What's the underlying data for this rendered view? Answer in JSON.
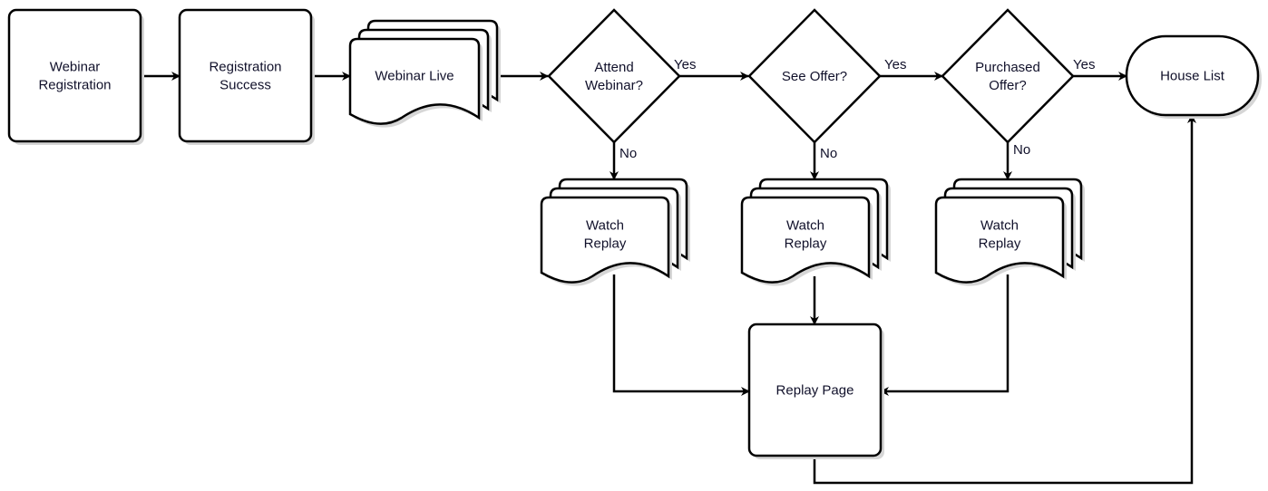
{
  "nodes": {
    "webinar_registration": {
      "lines": [
        "Webinar",
        "Registration"
      ],
      "shape": "rounded-rectangle"
    },
    "registration_success": {
      "lines": [
        "Registration",
        "Success"
      ],
      "shape": "rounded-rectangle"
    },
    "webinar_live": {
      "lines": [
        "Webinar Live"
      ],
      "shape": "multi-document"
    },
    "attend_webinar": {
      "lines": [
        "Attend",
        "Webinar?"
      ],
      "shape": "decision"
    },
    "see_offer": {
      "lines": [
        "See Offer?"
      ],
      "shape": "decision"
    },
    "purchased_offer": {
      "lines": [
        "Purchased",
        "Offer?"
      ],
      "shape": "decision"
    },
    "house_list": {
      "lines": [
        "House List"
      ],
      "shape": "terminator"
    },
    "watch_replay_1": {
      "lines": [
        "Watch",
        "Replay"
      ],
      "shape": "multi-document"
    },
    "watch_replay_2": {
      "lines": [
        "Watch",
        "Replay"
      ],
      "shape": "multi-document"
    },
    "watch_replay_3": {
      "lines": [
        "Watch",
        "Replay"
      ],
      "shape": "multi-document"
    },
    "replay_page": {
      "lines": [
        "Replay Page"
      ],
      "shape": "rounded-rectangle"
    }
  },
  "edges": [
    {
      "from": "webinar_registration",
      "to": "registration_success",
      "label": ""
    },
    {
      "from": "registration_success",
      "to": "webinar_live",
      "label": ""
    },
    {
      "from": "webinar_live",
      "to": "attend_webinar",
      "label": ""
    },
    {
      "from": "attend_webinar",
      "to": "see_offer",
      "label": "Yes"
    },
    {
      "from": "see_offer",
      "to": "purchased_offer",
      "label": "Yes"
    },
    {
      "from": "purchased_offer",
      "to": "house_list",
      "label": "Yes"
    },
    {
      "from": "attend_webinar",
      "to": "watch_replay_1",
      "label": "No"
    },
    {
      "from": "see_offer",
      "to": "watch_replay_2",
      "label": "No"
    },
    {
      "from": "purchased_offer",
      "to": "watch_replay_3",
      "label": "No"
    },
    {
      "from": "watch_replay_1",
      "to": "replay_page",
      "label": ""
    },
    {
      "from": "watch_replay_2",
      "to": "replay_page",
      "label": ""
    },
    {
      "from": "watch_replay_3",
      "to": "replay_page",
      "label": ""
    },
    {
      "from": "replay_page",
      "to": "house_list",
      "label": ""
    }
  ]
}
